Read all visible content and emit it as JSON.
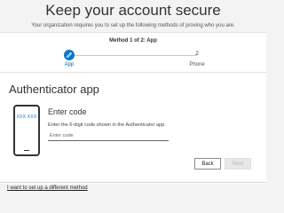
{
  "header": {
    "title": "Keep your account secure",
    "subtitle": "Your organization requires you to set up the following methods of proving who you are."
  },
  "progress": {
    "current_label": "Method 1 of 2: App",
    "steps": [
      {
        "number": "1",
        "label": "App",
        "icon": "check-pencil-icon",
        "active": true
      },
      {
        "number": "2",
        "label": "Phone",
        "active": false
      }
    ],
    "accent_color": "#0078d4"
  },
  "section": {
    "title": "Authenticator app",
    "phone_placeholder_text": "XXX XXX"
  },
  "form": {
    "heading": "Enter code",
    "instructions": "Enter the 6-digit code shown in the Authenticator app.",
    "code_value": "",
    "code_placeholder": "Enter code"
  },
  "buttons": {
    "back_label": "Back",
    "next_label": "Next"
  },
  "footer": {
    "alternate_link": "I want to set up a different method"
  }
}
